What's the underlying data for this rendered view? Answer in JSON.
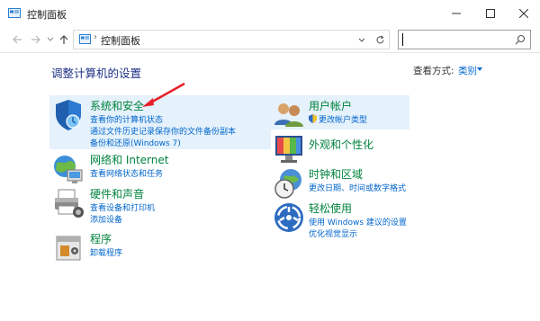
{
  "window": {
    "title": "控制面板"
  },
  "address": {
    "path": "控制面板",
    "separator": "›",
    "search_placeholder": ""
  },
  "content": {
    "heading": "调整计算机的设置",
    "view_by_label": "查看方式:",
    "view_by_value": "类别"
  },
  "categories": {
    "system": {
      "title": "系统和安全",
      "links": [
        "查看你的计算机状态",
        "通过文件历史记录保存你的文件备份副本",
        "备份和还原(Windows 7)"
      ]
    },
    "network": {
      "title": "网络和 Internet",
      "links": [
        "查看网络状态和任务"
      ]
    },
    "hardware": {
      "title": "硬件和声音",
      "links": [
        "查看设备和打印机",
        "添加设备"
      ]
    },
    "programs": {
      "title": "程序",
      "links": [
        "卸载程序"
      ]
    },
    "user": {
      "title": "用户帐户",
      "links": [
        "更改帐户类型"
      ]
    },
    "appearance": {
      "title": "外观和个性化",
      "links": []
    },
    "clock": {
      "title": "时钟和区域",
      "links": [
        "更改日期、时间或数字格式"
      ]
    },
    "ease": {
      "title": "轻松使用",
      "links": [
        "使用 Windows 建议的设置",
        "优化视觉显示"
      ]
    }
  },
  "colors": {
    "heading": "#1e3287",
    "category_title": "#00833c",
    "link": "#0066cc",
    "hover_bg": "#e5f1fb",
    "annotation_arrow": "#e8202a"
  }
}
